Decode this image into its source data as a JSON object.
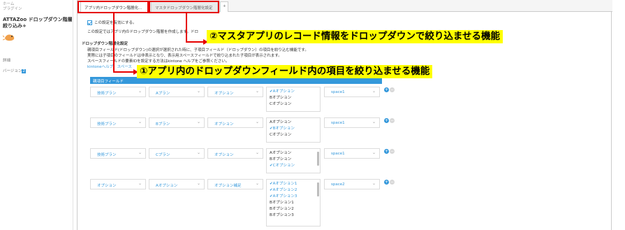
{
  "sidebar": {
    "breadcrumb1": "ホーム",
    "breadcrumb2": "プラグイン",
    "title": "ATTAZoo ドロップダウン階層絞り込み+",
    "detail_label": "詳細",
    "version_label": "バージョン",
    "version_value": "2"
  },
  "tabs": [
    {
      "label": "アプリ内ドロップダウン階層化..."
    },
    {
      "label": "マスタドロップダウン階層化設定"
    },
    {
      "label": "+"
    }
  ],
  "settings": {
    "enable_label": "この設定を有効にする。",
    "enable_desc": "この設定ではアプリ内のドロップダウン階層を作成します。ドロ",
    "section_title": "ドロップダウン階層化設定",
    "desc_line1": "親項目フィールド(ドロップダウン)の選択が選択された時に、子項目フィールド（ドロップダウン）の項目を絞り込む機能です。",
    "desc_line2": "実際には子項目のフィールドは非表示となり、表示用スペースフィールドで絞り込まれた子項目が表示されます。",
    "desc_line3": "スペースフィールドの要素IDを設定する方法はkintone ヘルプをご参照ください。",
    "help_link": "kintoneヘルプ：スペース"
  },
  "table": {
    "header": "親項目フィールド",
    "rows": [
      {
        "parent": "技術プラン",
        "value": "Aプラン",
        "child": "オプション",
        "items": [
          {
            "t": "Aオプション",
            "s": true
          },
          {
            "t": "Bオプション",
            "s": false
          },
          {
            "t": "Cオプション",
            "s": false
          }
        ],
        "space": "space1"
      },
      {
        "parent": "技術プラン",
        "value": "Bプラン",
        "child": "オプション",
        "items": [
          {
            "t": "Aオプション",
            "s": false
          },
          {
            "t": "Bオプション",
            "s": true
          },
          {
            "t": "Cオプション",
            "s": false
          }
        ],
        "space": "space1"
      },
      {
        "parent": "技術プラン",
        "value": "Cプラン",
        "child": "オプション",
        "items": [
          {
            "t": "Aオプション",
            "s": false
          },
          {
            "t": "Bオプション",
            "s": false
          },
          {
            "t": "Cオプション",
            "s": true
          }
        ],
        "space": "space1"
      },
      {
        "parent": "オプション",
        "value": "Aオプション",
        "child": "オプション補足",
        "items": [
          {
            "t": "Aオプション1",
            "s": true
          },
          {
            "t": "Aオプション2",
            "s": true
          },
          {
            "t": "Aオプション3",
            "s": true
          },
          {
            "t": "Bオプション1",
            "s": false
          },
          {
            "t": "Bオプション2",
            "s": false
          },
          {
            "t": "Bオプション3",
            "s": false
          }
        ],
        "space": "space2"
      }
    ]
  },
  "annotations": {
    "callout1": "①アプリ内のドロップダウンフィールド内の項目を絞り込ませる機能",
    "callout2": "②マスタアプリのレコード情報をドロップダウンで絞り込ませる機能",
    "color_red": "#e60000",
    "color_yellow": "#ffff00"
  },
  "colors": {
    "accent": "#3498db"
  }
}
